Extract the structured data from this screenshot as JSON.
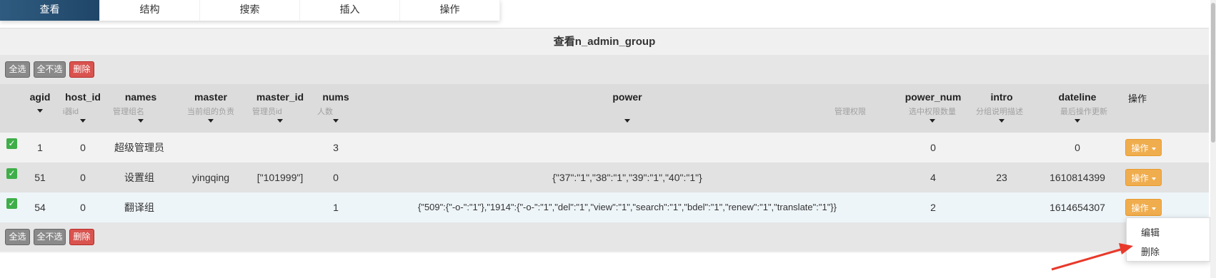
{
  "tabs": [
    {
      "label": "查看"
    },
    {
      "label": "结构"
    },
    {
      "label": "搜索"
    },
    {
      "label": "插入"
    },
    {
      "label": "操作"
    }
  ],
  "panel": {
    "title": "查看n_admin_group"
  },
  "toolbar": {
    "select_all": "全选",
    "select_none": "全不选",
    "delete": "删除"
  },
  "columns": [
    {
      "name": "agid",
      "sub": ""
    },
    {
      "name": "host_id",
      "sub": "i器id"
    },
    {
      "name": "names",
      "sub": "管理组名"
    },
    {
      "name": "master",
      "sub": "当前组的负责"
    },
    {
      "name": "master_id",
      "sub": "管理员id"
    },
    {
      "name": "nums",
      "sub": "人数"
    },
    {
      "name": "power",
      "sub": "管理权限"
    },
    {
      "name": "power_num",
      "sub": "选中权限数量"
    },
    {
      "name": "intro",
      "sub": "分组说明描述"
    },
    {
      "name": "dateline",
      "sub": "最后操作更新"
    },
    {
      "name": "操作",
      "sub": ""
    }
  ],
  "rows": [
    {
      "agid": "1",
      "host_id": "0",
      "names": "超级管理员",
      "master": "",
      "master_id": "",
      "nums": "3",
      "power": "",
      "power_num": "0",
      "intro": "",
      "dateline": "0",
      "op": "操作"
    },
    {
      "agid": "51",
      "host_id": "0",
      "names": "设置组",
      "master": "yingqing",
      "master_id": "[\"101999\"]",
      "nums": "0",
      "power": "{\"37\":\"1\",\"38\":\"1\",\"39\":\"1\",\"40\":\"1\"}",
      "power_num": "4",
      "intro": "23",
      "dateline": "1610814399",
      "op": "操作"
    },
    {
      "agid": "54",
      "host_id": "0",
      "names": "翻译组",
      "master": "",
      "master_id": "",
      "nums": "1",
      "power": "{\"509\":{\"-o-\":\"1\"},\"1914\":{\"-o-\":\"1\",\"del\":\"1\",\"view\":\"1\",\"search\":\"1\",\"bdel\":\"1\",\"renew\":\"1\",\"translate\":\"1\"}}",
      "power_num": "2",
      "intro": "",
      "dateline": "1614654307",
      "op": "操作"
    }
  ],
  "dropdown": {
    "edit": "编辑",
    "delete": "删除"
  },
  "colors": {
    "tab_active": "#2f5b80",
    "delete": "#d9534f",
    "op": "#f0ad4e",
    "check": "#3fae49",
    "arrow": "#e8392b"
  },
  "icons": {
    "checkbox": "checkmark-icon",
    "sort": "sort-caret-icon",
    "dropdown": "chevron-down-icon",
    "annotation": "red-arrow"
  }
}
